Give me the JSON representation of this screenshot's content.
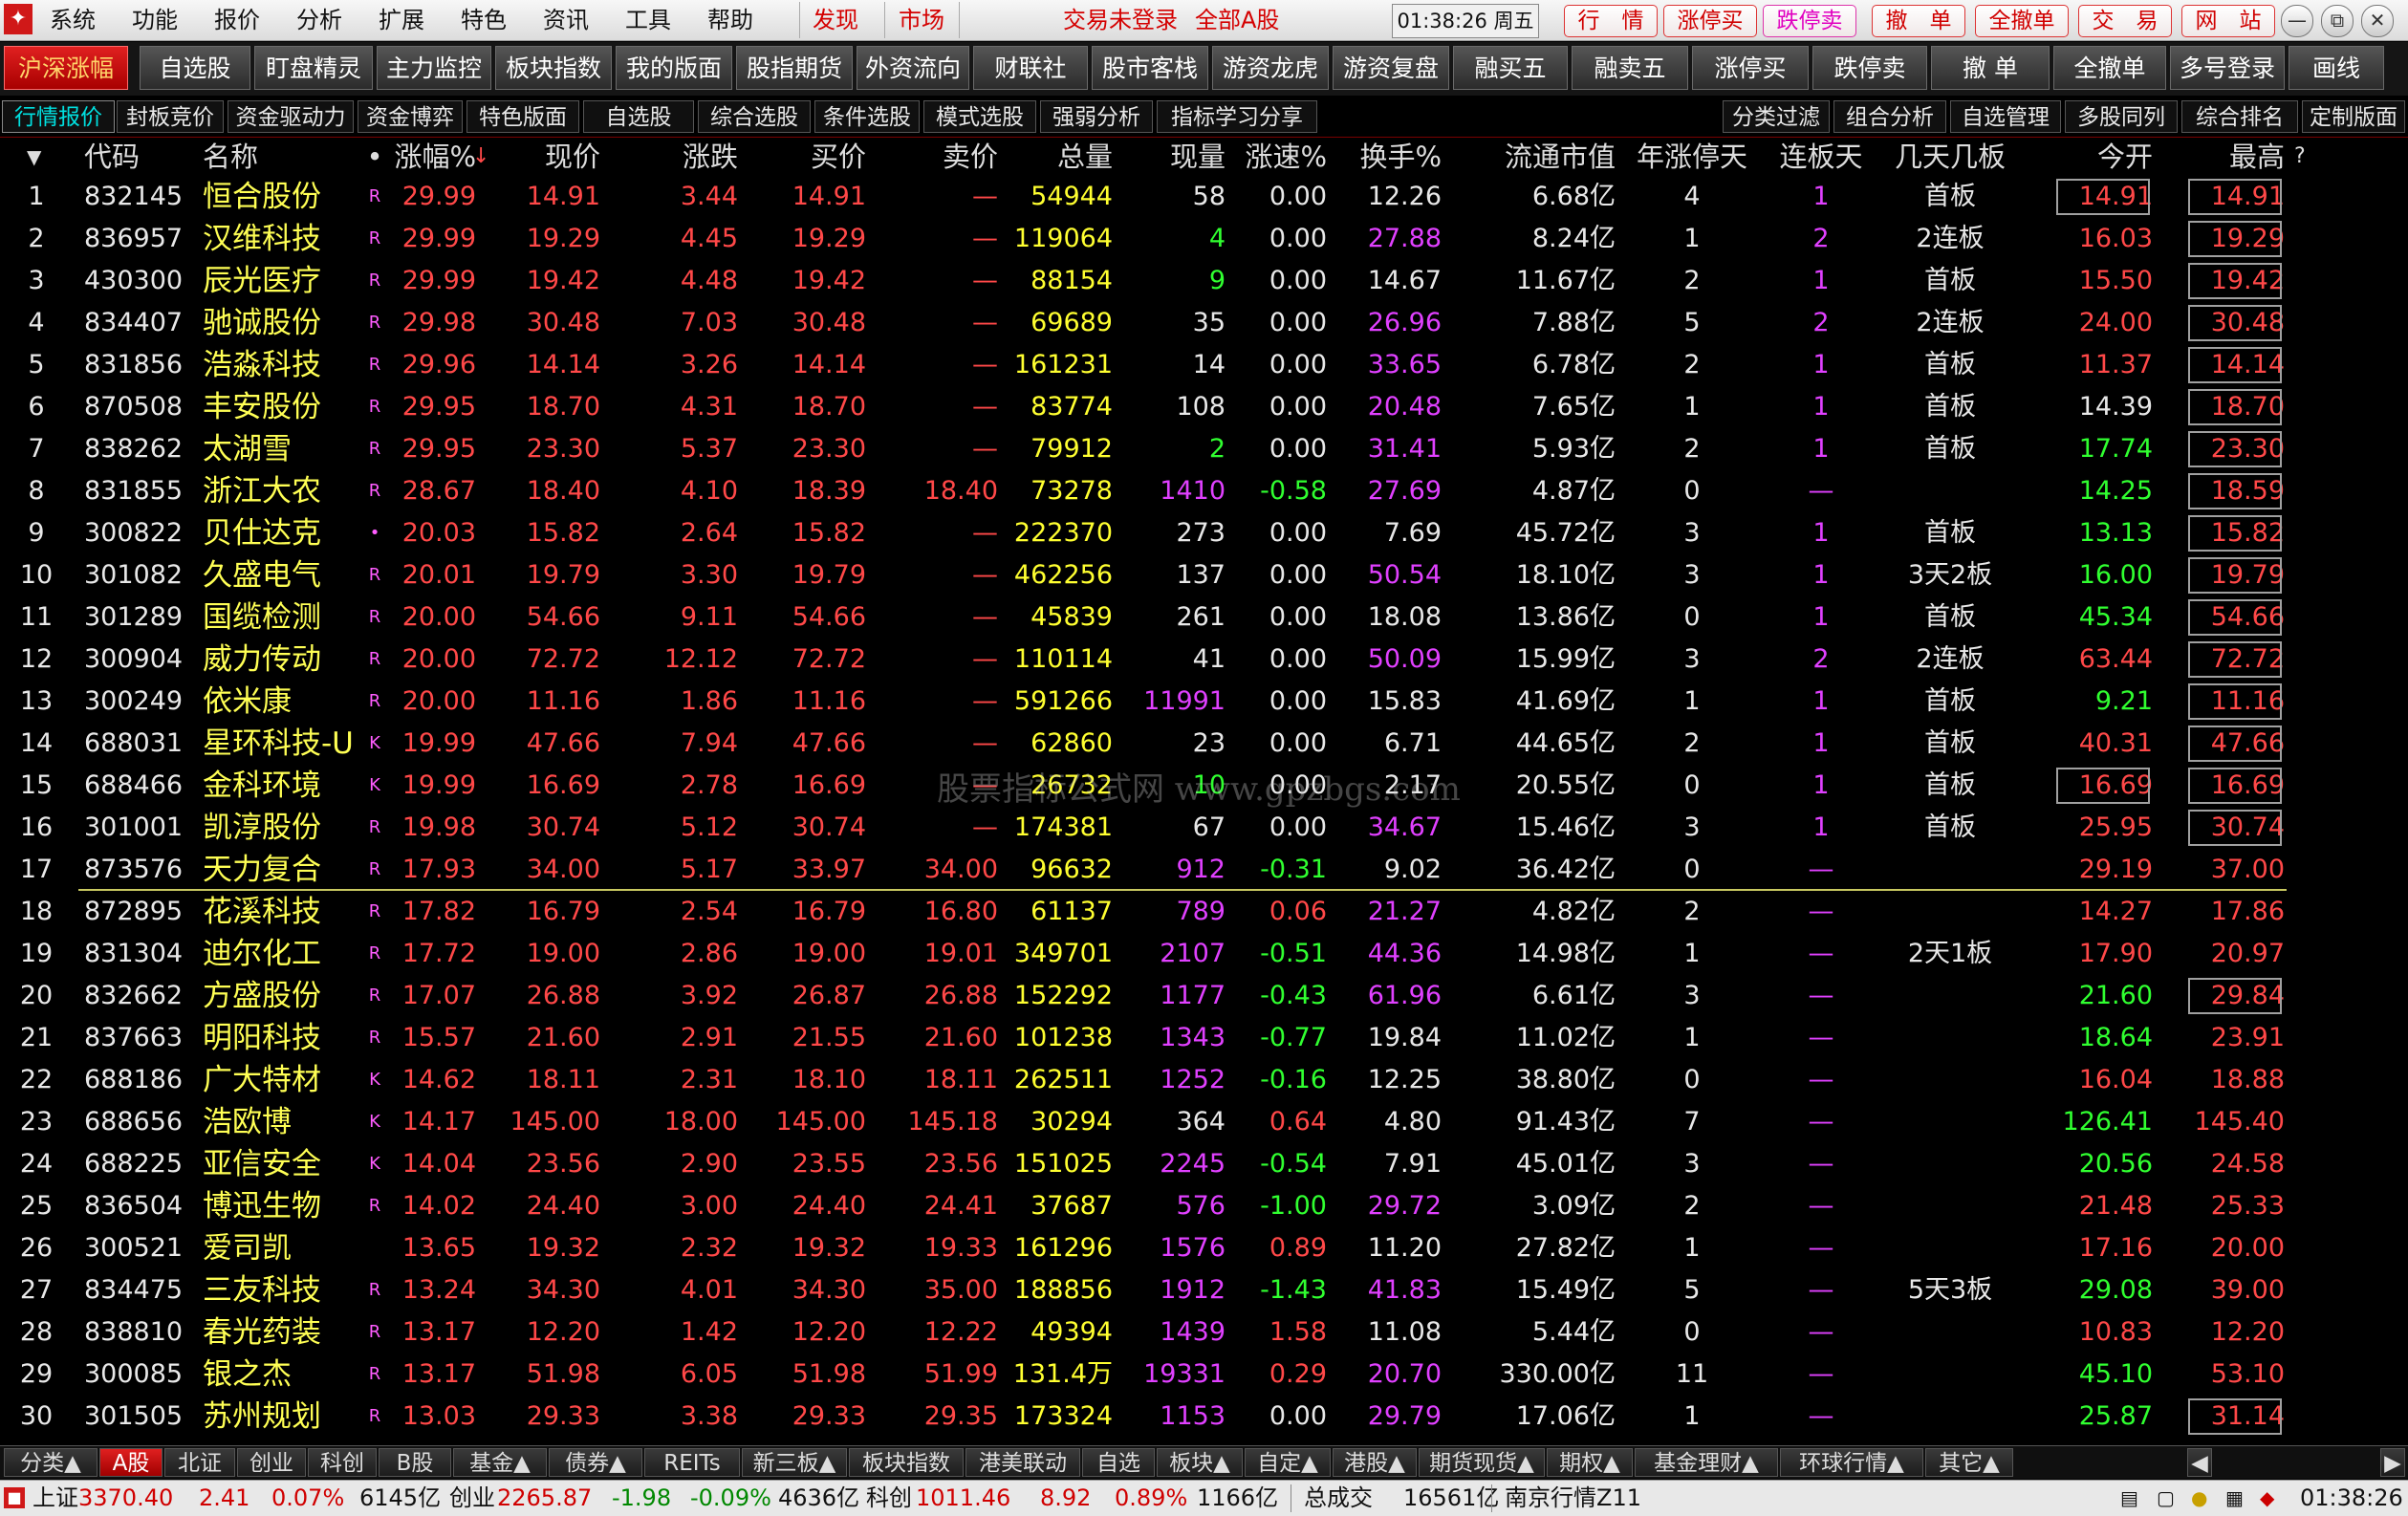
{
  "menubar": {
    "logo": "✦",
    "items": [
      "系统",
      "功能",
      "报价",
      "分析",
      "扩展",
      "特色",
      "资讯",
      "工具",
      "帮助"
    ],
    "discover": "发现",
    "market": "市场",
    "login_status": "交易未登录",
    "stock_scope": "全部A股",
    "clock": "01:38:26 周五",
    "buttons": [
      "行　情",
      "涨停买",
      "跌停卖",
      "撤　单",
      "全撤单",
      "交　易",
      "网　站"
    ],
    "win_buttons": [
      "—",
      "⧉",
      "✕"
    ]
  },
  "module_buttons": [
    "沪深涨幅",
    "自选股",
    "盯盘精灵",
    "主力监控",
    "板块指数",
    "我的版面",
    "股指期货",
    "外资流向",
    "财联社",
    "股市客栈",
    "游资龙虎",
    "游资复盘",
    "融买五",
    "融卖五",
    "涨停买",
    "跌停卖",
    "撤 单",
    "全撤单",
    "多号登录",
    "画线"
  ],
  "sub_tabs_left": [
    "行情报价",
    "封板竞价",
    "资金驱动力",
    "资金博弈",
    "特色版面",
    "自选股",
    "综合选股",
    "条件选股",
    "模式选股",
    "强弱分析",
    "指标学习分享"
  ],
  "sub_tabs_right": [
    "分类过滤",
    "组合分析",
    "自选管理",
    "多股同列",
    "综合排名",
    "定制版面"
  ],
  "columns": [
    "代码",
    "名称",
    "•",
    "涨幅%",
    "现价",
    "涨跌",
    "买价",
    "卖价",
    "总量",
    "现量",
    "涨速%",
    "换手%",
    "流通市值",
    "年涨停天",
    "连板天",
    "几天几板",
    "今开",
    "最高"
  ],
  "sort_indicator": "↓",
  "header_marker": "▼",
  "help_marker": "?",
  "rows": [
    [
      "1",
      "832145",
      "恒合股份",
      "R",
      "29.99",
      "14.91",
      "3.44",
      "14.91",
      "—",
      "54944",
      "58",
      "0.00",
      "12.26",
      "6.68亿",
      "4",
      "1",
      "首板",
      "14.91",
      "14.91"
    ],
    [
      "2",
      "836957",
      "汉维科技",
      "R",
      "29.99",
      "19.29",
      "4.45",
      "19.29",
      "—",
      "119064",
      "4",
      "0.00",
      "27.88",
      "8.24亿",
      "1",
      "2",
      "2连板",
      "16.03",
      "19.29"
    ],
    [
      "3",
      "430300",
      "辰光医疗",
      "R",
      "29.99",
      "19.42",
      "4.48",
      "19.42",
      "—",
      "88154",
      "9",
      "0.00",
      "14.67",
      "11.67亿",
      "2",
      "1",
      "首板",
      "15.50",
      "19.42"
    ],
    [
      "4",
      "834407",
      "驰诚股份",
      "R",
      "29.98",
      "30.48",
      "7.03",
      "30.48",
      "—",
      "69689",
      "35",
      "0.00",
      "26.96",
      "7.88亿",
      "5",
      "2",
      "2连板",
      "24.00",
      "30.48"
    ],
    [
      "5",
      "831856",
      "浩淼科技",
      "R",
      "29.96",
      "14.14",
      "3.26",
      "14.14",
      "—",
      "161231",
      "14",
      "0.00",
      "33.65",
      "6.78亿",
      "2",
      "1",
      "首板",
      "11.37",
      "14.14"
    ],
    [
      "6",
      "870508",
      "丰安股份",
      "R",
      "29.95",
      "18.70",
      "4.31",
      "18.70",
      "—",
      "83774",
      "108",
      "0.00",
      "20.48",
      "7.65亿",
      "1",
      "1",
      "首板",
      "14.39",
      "18.70"
    ],
    [
      "7",
      "838262",
      "太湖雪",
      "R",
      "29.95",
      "23.30",
      "5.37",
      "23.30",
      "—",
      "79912",
      "2",
      "0.00",
      "31.41",
      "5.93亿",
      "2",
      "1",
      "首板",
      "17.74",
      "23.30"
    ],
    [
      "8",
      "831855",
      "浙江大农",
      "R",
      "28.67",
      "18.40",
      "4.10",
      "18.39",
      "18.40",
      "73278",
      "1410",
      "-0.58",
      "27.69",
      "4.87亿",
      "0",
      "—",
      "",
      "14.25",
      "18.59"
    ],
    [
      "9",
      "300822",
      "贝仕达克",
      "•",
      "20.03",
      "15.82",
      "2.64",
      "15.82",
      "—",
      "222370",
      "273",
      "0.00",
      "7.69",
      "45.72亿",
      "3",
      "1",
      "首板",
      "13.13",
      "15.82"
    ],
    [
      "10",
      "301082",
      "久盛电气",
      "R",
      "20.01",
      "19.79",
      "3.30",
      "19.79",
      "—",
      "462256",
      "137",
      "0.00",
      "50.54",
      "18.10亿",
      "3",
      "1",
      "3天2板",
      "16.00",
      "19.79"
    ],
    [
      "11",
      "301289",
      "国缆检测",
      "R",
      "20.00",
      "54.66",
      "9.11",
      "54.66",
      "—",
      "45839",
      "261",
      "0.00",
      "18.08",
      "13.86亿",
      "0",
      "1",
      "首板",
      "45.34",
      "54.66"
    ],
    [
      "12",
      "300904",
      "威力传动",
      "R",
      "20.00",
      "72.72",
      "12.12",
      "72.72",
      "—",
      "110114",
      "41",
      "0.00",
      "50.09",
      "15.99亿",
      "3",
      "2",
      "2连板",
      "63.44",
      "72.72"
    ],
    [
      "13",
      "300249",
      "依米康",
      "R",
      "20.00",
      "11.16",
      "1.86",
      "11.16",
      "—",
      "591266",
      "11991",
      "0.00",
      "15.83",
      "41.69亿",
      "1",
      "1",
      "首板",
      "9.21",
      "11.16"
    ],
    [
      "14",
      "688031",
      "星环科技-U",
      "K",
      "19.99",
      "47.66",
      "7.94",
      "47.66",
      "—",
      "62860",
      "23",
      "0.00",
      "6.71",
      "44.65亿",
      "2",
      "1",
      "首板",
      "40.31",
      "47.66"
    ],
    [
      "15",
      "688466",
      "金科环境",
      "K",
      "19.99",
      "16.69",
      "2.78",
      "16.69",
      "—",
      "26732",
      "10",
      "0.00",
      "2.17",
      "20.55亿",
      "0",
      "1",
      "首板",
      "16.69",
      "16.69"
    ],
    [
      "16",
      "301001",
      "凯淳股份",
      "R",
      "19.98",
      "30.74",
      "5.12",
      "30.74",
      "—",
      "174381",
      "67",
      "0.00",
      "34.67",
      "15.46亿",
      "3",
      "1",
      "首板",
      "25.95",
      "30.74"
    ],
    [
      "17",
      "873576",
      "天力复合",
      "R",
      "17.93",
      "34.00",
      "5.17",
      "33.97",
      "34.00",
      "96632",
      "912",
      "-0.31",
      "9.02",
      "36.42亿",
      "0",
      "—",
      "",
      "29.19",
      "37.00"
    ],
    [
      "18",
      "872895",
      "花溪科技",
      "R",
      "17.82",
      "16.79",
      "2.54",
      "16.79",
      "16.80",
      "61137",
      "789",
      "0.06",
      "21.27",
      "4.82亿",
      "2",
      "—",
      "",
      "14.27",
      "17.86"
    ],
    [
      "19",
      "831304",
      "迪尔化工",
      "R",
      "17.72",
      "19.00",
      "2.86",
      "19.00",
      "19.01",
      "349701",
      "2107",
      "-0.51",
      "44.36",
      "14.98亿",
      "1",
      "—",
      "2天1板",
      "17.90",
      "20.97"
    ],
    [
      "20",
      "832662",
      "方盛股份",
      "R",
      "17.07",
      "26.88",
      "3.92",
      "26.87",
      "26.88",
      "152292",
      "1177",
      "-0.43",
      "61.96",
      "6.61亿",
      "3",
      "—",
      "",
      "21.60",
      "29.84"
    ],
    [
      "21",
      "837663",
      "明阳科技",
      "R",
      "15.57",
      "21.60",
      "2.91",
      "21.55",
      "21.60",
      "101238",
      "1343",
      "-0.77",
      "19.84",
      "11.02亿",
      "1",
      "—",
      "",
      "18.64",
      "23.91"
    ],
    [
      "22",
      "688186",
      "广大特材",
      "K",
      "14.62",
      "18.11",
      "2.31",
      "18.10",
      "18.11",
      "262511",
      "1252",
      "-0.16",
      "12.25",
      "38.80亿",
      "0",
      "—",
      "",
      "16.04",
      "18.88"
    ],
    [
      "23",
      "688656",
      "浩欧博",
      "K",
      "14.17",
      "145.00",
      "18.00",
      "145.00",
      "145.18",
      "30294",
      "364",
      "0.64",
      "4.80",
      "91.43亿",
      "7",
      "—",
      "",
      "126.41",
      "145.40"
    ],
    [
      "24",
      "688225",
      "亚信安全",
      "K",
      "14.04",
      "23.56",
      "2.90",
      "23.55",
      "23.56",
      "151025",
      "2245",
      "-0.54",
      "7.91",
      "45.01亿",
      "3",
      "—",
      "",
      "20.56",
      "24.58"
    ],
    [
      "25",
      "836504",
      "博迅生物",
      "R",
      "14.02",
      "24.40",
      "3.00",
      "24.40",
      "24.41",
      "37687",
      "576",
      "-1.00",
      "29.72",
      "3.09亿",
      "2",
      "—",
      "",
      "21.48",
      "25.33"
    ],
    [
      "26",
      "300521",
      "爱司凯",
      "",
      "13.65",
      "19.32",
      "2.32",
      "19.32",
      "19.33",
      "161296",
      "1576",
      "0.89",
      "11.20",
      "27.82亿",
      "1",
      "—",
      "",
      "17.16",
      "20.00"
    ],
    [
      "27",
      "834475",
      "三友科技",
      "R",
      "13.24",
      "34.30",
      "4.01",
      "34.30",
      "35.00",
      "188856",
      "1912",
      "-1.43",
      "41.83",
      "15.49亿",
      "5",
      "—",
      "5天3板",
      "29.08",
      "39.00"
    ],
    [
      "28",
      "838810",
      "春光药装",
      "R",
      "13.17",
      "12.20",
      "1.42",
      "12.20",
      "12.22",
      "49394",
      "1439",
      "1.58",
      "11.08",
      "5.44亿",
      "0",
      "—",
      "",
      "10.83",
      "12.20"
    ],
    [
      "29",
      "300085",
      "银之杰",
      "R",
      "13.17",
      "51.98",
      "6.05",
      "51.98",
      "51.99",
      "131.4万",
      "19331",
      "0.29",
      "20.70",
      "330.00亿",
      "11",
      "—",
      "",
      "45.10",
      "53.10"
    ],
    [
      "30",
      "301505",
      "苏州规划",
      "R",
      "13.03",
      "29.33",
      "3.38",
      "29.33",
      "29.35",
      "173324",
      "1153",
      "0.00",
      "29.79",
      "17.06亿",
      "1",
      "—",
      "",
      "25.87",
      "31.14"
    ]
  ],
  "watermark": "股票指标公式网 www.gpzbgs.com",
  "category_tabs": [
    "分类▲",
    "A股",
    "北证",
    "创业",
    "科创",
    "B股",
    "基金▲",
    "债券▲",
    "REITs",
    "新三板▲",
    "板块指数",
    "港美联动",
    "自选",
    "板块▲",
    "自定▲",
    "港股▲",
    "期货现货▲",
    "期权▲",
    "基金理财▲",
    "环球行情▲",
    "其它▲"
  ],
  "statusbar": {
    "sh_label": "上证",
    "sh_value": "3370.40",
    "sh_change": "2.41",
    "sh_pct": "0.07%",
    "sh_amount": "6145亿",
    "cy_label": "创业",
    "cy_value": "2265.87",
    "cy_change": "-1.98",
    "cy_pct": "-0.09%",
    "cy_amount": "4636亿",
    "kc_label": "科创",
    "kc_value": "1011.46",
    "kc_change": "8.92",
    "kc_pct": "0.89%",
    "kc_amount": "1166亿",
    "total_label": "总成交",
    "total_value": "16561亿",
    "server": "南京行情Z11",
    "time": "01:38:26"
  },
  "colors": {
    "up": "#ff4848",
    "down": "#30ff30",
    "name": "#ffff54",
    "high_turnover": "#e040ff",
    "active_tab": "#d01010"
  }
}
